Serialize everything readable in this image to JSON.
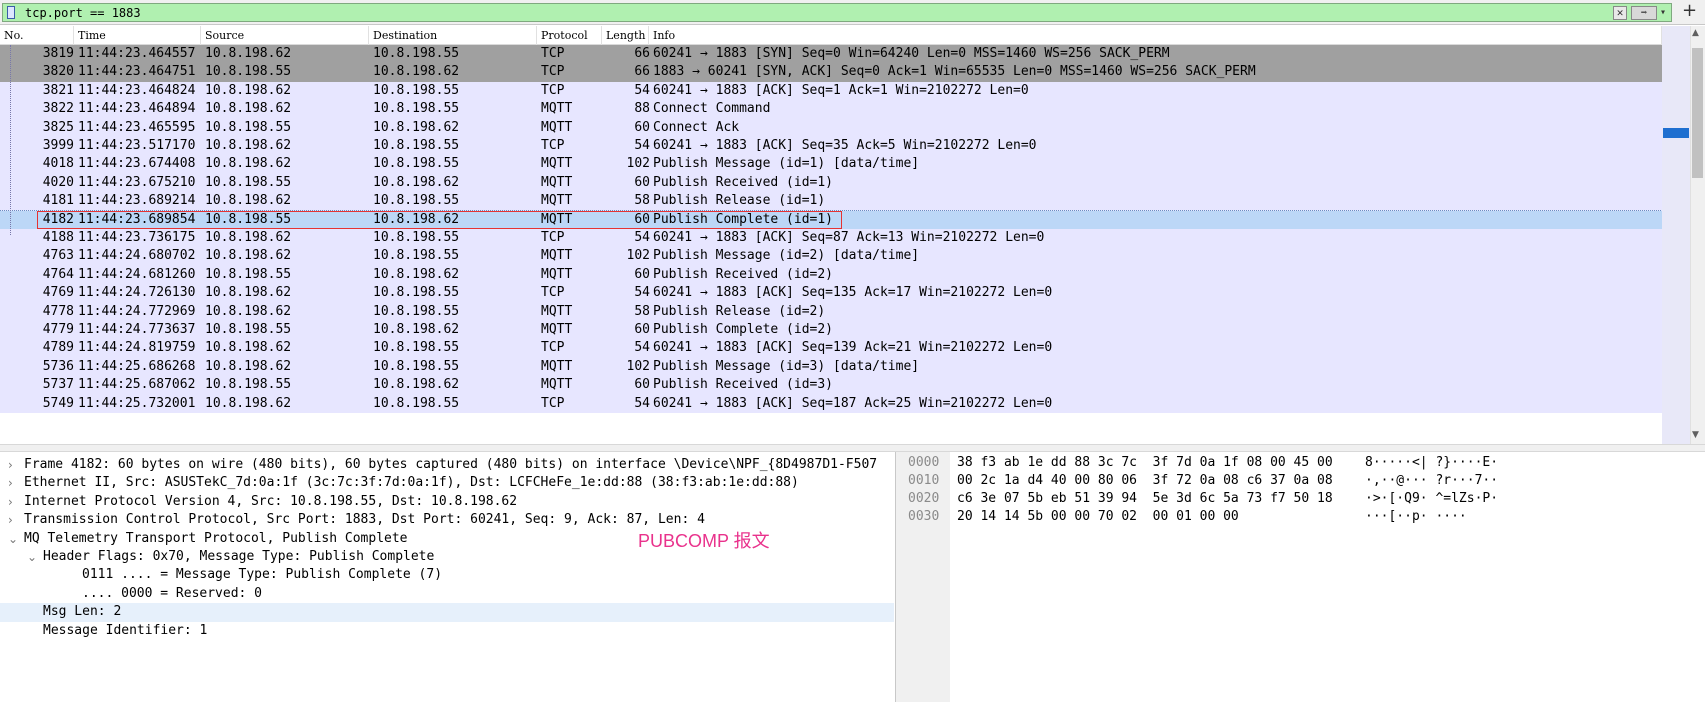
{
  "filter": {
    "text": "tcp.port == 1883",
    "clear_symbol": "✕",
    "apply_symbol": "➡",
    "dropdown_symbol": "▾",
    "add_symbol": "+"
  },
  "packet_list": {
    "columns": [
      "No.",
      "Time",
      "Source",
      "Destination",
      "Protocol",
      "Length",
      "Info"
    ],
    "rows": [
      {
        "no": "3819",
        "time": "11:44:23.464557",
        "src": "10.8.198.62",
        "dst": "10.8.198.55",
        "proto": "TCP",
        "len": "66",
        "info": "60241 → 1883 [SYN] Seq=0 Win=64240 Len=0 MSS=1460 WS=256 SACK_PERM",
        "style": "dark"
      },
      {
        "no": "3820",
        "time": "11:44:23.464751",
        "src": "10.8.198.55",
        "dst": "10.8.198.62",
        "proto": "TCP",
        "len": "66",
        "info": "1883 → 60241 [SYN, ACK] Seq=0 Ack=1 Win=65535 Len=0 MSS=1460 WS=256 SACK_PERM",
        "style": "dark"
      },
      {
        "no": "3821",
        "time": "11:44:23.464824",
        "src": "10.8.198.62",
        "dst": "10.8.198.55",
        "proto": "TCP",
        "len": "54",
        "info": "60241 → 1883 [ACK] Seq=1 Ack=1 Win=2102272 Len=0",
        "style": "normal"
      },
      {
        "no": "3822",
        "time": "11:44:23.464894",
        "src": "10.8.198.62",
        "dst": "10.8.198.55",
        "proto": "MQTT",
        "len": "88",
        "info": "Connect Command",
        "style": "normal"
      },
      {
        "no": "3825",
        "time": "11:44:23.465595",
        "src": "10.8.198.55",
        "dst": "10.8.198.62",
        "proto": "MQTT",
        "len": "60",
        "info": "Connect Ack",
        "style": "normal"
      },
      {
        "no": "3999",
        "time": "11:44:23.517170",
        "src": "10.8.198.62",
        "dst": "10.8.198.55",
        "proto": "TCP",
        "len": "54",
        "info": "60241 → 1883 [ACK] Seq=35 Ack=5 Win=2102272 Len=0",
        "style": "normal"
      },
      {
        "no": "4018",
        "time": "11:44:23.674408",
        "src": "10.8.198.62",
        "dst": "10.8.198.55",
        "proto": "MQTT",
        "len": "102",
        "info": "Publish Message (id=1) [data/time]",
        "style": "normal"
      },
      {
        "no": "4020",
        "time": "11:44:23.675210",
        "src": "10.8.198.55",
        "dst": "10.8.198.62",
        "proto": "MQTT",
        "len": "60",
        "info": "Publish Received (id=1)",
        "style": "normal"
      },
      {
        "no": "4181",
        "time": "11:44:23.689214",
        "src": "10.8.198.62",
        "dst": "10.8.198.55",
        "proto": "MQTT",
        "len": "58",
        "info": "Publish Release (id=1)",
        "style": "normal"
      },
      {
        "no": "4182",
        "time": "11:44:23.689854",
        "src": "10.8.198.55",
        "dst": "10.8.198.62",
        "proto": "MQTT",
        "len": "60",
        "info": "Publish Complete (id=1)",
        "style": "selected"
      },
      {
        "no": "4188",
        "time": "11:44:23.736175",
        "src": "10.8.198.62",
        "dst": "10.8.198.55",
        "proto": "TCP",
        "len": "54",
        "info": "60241 → 1883 [ACK] Seq=87 Ack=13 Win=2102272 Len=0",
        "style": "normal"
      },
      {
        "no": "4763",
        "time": "11:44:24.680702",
        "src": "10.8.198.62",
        "dst": "10.8.198.55",
        "proto": "MQTT",
        "len": "102",
        "info": "Publish Message (id=2) [data/time]",
        "style": "normal"
      },
      {
        "no": "4764",
        "time": "11:44:24.681260",
        "src": "10.8.198.55",
        "dst": "10.8.198.62",
        "proto": "MQTT",
        "len": "60",
        "info": "Publish Received (id=2)",
        "style": "normal"
      },
      {
        "no": "4769",
        "time": "11:44:24.726130",
        "src": "10.8.198.62",
        "dst": "10.8.198.55",
        "proto": "TCP",
        "len": "54",
        "info": "60241 → 1883 [ACK] Seq=135 Ack=17 Win=2102272 Len=0",
        "style": "normal"
      },
      {
        "no": "4778",
        "time": "11:44:24.772969",
        "src": "10.8.198.62",
        "dst": "10.8.198.55",
        "proto": "MQTT",
        "len": "58",
        "info": "Publish Release (id=2)",
        "style": "normal"
      },
      {
        "no": "4779",
        "time": "11:44:24.773637",
        "src": "10.8.198.55",
        "dst": "10.8.198.62",
        "proto": "MQTT",
        "len": "60",
        "info": "Publish Complete (id=2)",
        "style": "normal"
      },
      {
        "no": "4789",
        "time": "11:44:24.819759",
        "src": "10.8.198.62",
        "dst": "10.8.198.55",
        "proto": "TCP",
        "len": "54",
        "info": "60241 → 1883 [ACK] Seq=139 Ack=21 Win=2102272 Len=0",
        "style": "normal"
      },
      {
        "no": "5736",
        "time": "11:44:25.686268",
        "src": "10.8.198.62",
        "dst": "10.8.198.55",
        "proto": "MQTT",
        "len": "102",
        "info": "Publish Message (id=3) [data/time]",
        "style": "normal"
      },
      {
        "no": "5737",
        "time": "11:44:25.687062",
        "src": "10.8.198.55",
        "dst": "10.8.198.62",
        "proto": "MQTT",
        "len": "60",
        "info": "Publish Received (id=3)",
        "style": "normal"
      },
      {
        "no": "5749",
        "time": "11:44:25.732001",
        "src": "10.8.198.62",
        "dst": "10.8.198.55",
        "proto": "TCP",
        "len": "54",
        "info": "60241 → 1883 [ACK] Seq=187 Ack=25 Win=2102272 Len=0",
        "style": "normal"
      }
    ]
  },
  "details": [
    {
      "expander": "›",
      "indent": 0,
      "text": "Frame 4182: 60 bytes on wire (480 bits), 60 bytes captured (480 bits) on interface \\Device\\NPF_{8D4987D1-F507"
    },
    {
      "expander": "›",
      "indent": 0,
      "text": "Ethernet II, Src: ASUSTekC_7d:0a:1f (3c:7c:3f:7d:0a:1f), Dst: LCFCHeFe_1e:dd:88 (38:f3:ab:1e:dd:88)"
    },
    {
      "expander": "›",
      "indent": 0,
      "text": "Internet Protocol Version 4, Src: 10.8.198.55, Dst: 10.8.198.62"
    },
    {
      "expander": "›",
      "indent": 0,
      "text": "Transmission Control Protocol, Src Port: 1883, Dst Port: 60241, Seq: 9, Ack: 87, Len: 4"
    },
    {
      "expander": "⌄",
      "indent": 0,
      "text": "MQ Telemetry Transport Protocol, Publish Complete"
    },
    {
      "expander": "⌄",
      "indent": 1,
      "text": "Header Flags: 0x70, Message Type: Publish Complete"
    },
    {
      "expander": "",
      "indent": 2,
      "text": "0111 .... = Message Type: Publish Complete (7)"
    },
    {
      "expander": "",
      "indent": 2,
      "text": ".... 0000 = Reserved: 0"
    },
    {
      "expander": "",
      "indent": 1,
      "text": "Msg Len: 2",
      "highlight": true
    },
    {
      "expander": "",
      "indent": 1,
      "text": "Message Identifier: 1"
    }
  ],
  "annotation": "PUBCOMP 报文",
  "bytes": [
    {
      "offset": "0000",
      "hex": "38 f3 ab 1e dd 88 3c 7c  3f 7d 0a 1f 08 00 45 00",
      "ascii": "8·····<| ?}····E·"
    },
    {
      "offset": "0010",
      "hex": "00 2c 1a d4 40 00 80 06  3f 72 0a 08 c6 37 0a 08",
      "ascii": "·,··@··· ?r···7··"
    },
    {
      "offset": "0020",
      "hex": "c6 3e 07 5b eb 51 39 94  5e 3d 6c 5a 73 f7 50 18",
      "ascii": "·>·[·Q9· ^=lZs·P·"
    },
    {
      "offset": "0030",
      "hex": "20 14 14 5b 00 00 70 02  00 01 00 00",
      "ascii": "···[··p· ····"
    }
  ],
  "colors": {
    "row_normal": "#e7e6ff",
    "row_dark": "#a0a0a0",
    "row_selected": "#bcd7f7",
    "filter_bg": "#b0f0b0",
    "annotation": "#e9328c",
    "highlight_outline": "#e53333"
  }
}
